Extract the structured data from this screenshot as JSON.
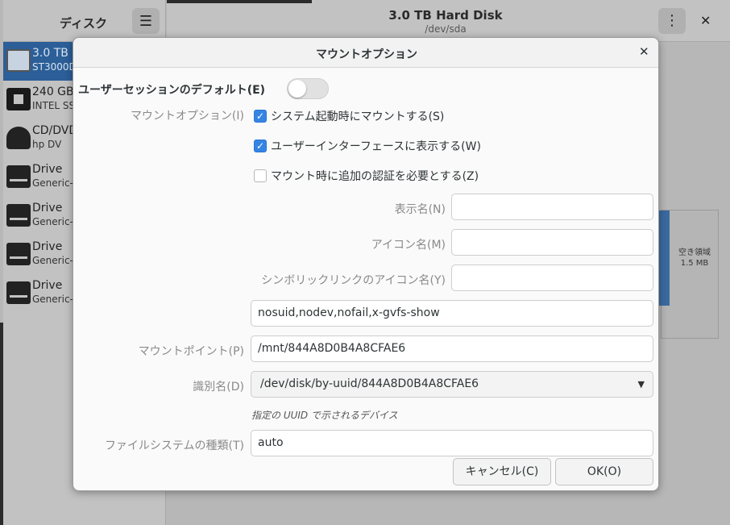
{
  "app": {
    "sidebar_title": "ディスク",
    "menu_icon": "☰",
    "window_title": "3.0 TB Hard Disk",
    "window_subtitle": "/dev/sda",
    "kebab_icon": "⋮",
    "close_icon": "✕",
    "drives": [
      {
        "name": "3.0 TB",
        "sub": "ST3000D",
        "selected": true,
        "icon": "harddisk-icon"
      },
      {
        "name": "240 GB",
        "sub": "INTEL SS",
        "selected": false,
        "icon": "ssd-chip-icon"
      },
      {
        "name": "CD/DVD",
        "sub": "hp      DV",
        "selected": false,
        "icon": "optical-drive-icon"
      },
      {
        "name": "Drive",
        "sub": "Generic-",
        "selected": false,
        "icon": "drive-icon"
      },
      {
        "name": "Drive",
        "sub": "Generic-",
        "selected": false,
        "icon": "drive-icon"
      },
      {
        "name": "Drive",
        "sub": "Generic-",
        "selected": false,
        "icon": "drive-icon"
      },
      {
        "name": "Drive",
        "sub": "Generic-",
        "selected": false,
        "icon": "drive-icon"
      }
    ],
    "free_space_label": "空き領域",
    "free_space_size": "1.5 MB"
  },
  "dialog": {
    "title": "マウントオプション",
    "close_icon": "✕",
    "session_default_label": "ユーザーセッションのデフォルト(E)",
    "session_default_on": false,
    "mount_options_label": "マウントオプション(I)",
    "checkboxes": [
      {
        "label": "システム起動時にマウントする(S)",
        "checked": true
      },
      {
        "label": "ユーザーインターフェースに表示する(W)",
        "checked": true
      },
      {
        "label": "マウント時に追加の認証を必要とする(Z)",
        "checked": false
      }
    ],
    "display_name_label": "表示名(N)",
    "display_name_value": "",
    "icon_name_label": "アイコン名(M)",
    "icon_name_value": "",
    "symbolic_icon_label": "シンボリックリンクのアイコン名(Y)",
    "symbolic_icon_value": "",
    "options_value": "nosuid,nodev,nofail,x-gvfs-show",
    "mount_point_label": "マウントポイント(P)",
    "mount_point_value": "/mnt/844A8D0B4A8CFAE6",
    "identify_label": "識別名(D)",
    "identify_value": "/dev/disk/by-uuid/844A8D0B4A8CFAE6",
    "identify_hint": "指定の UUID で示されるデバイス",
    "fstype_label": "ファイルシステムの種類(T)",
    "fstype_value": "auto",
    "cancel_label": "キャンセル(C)",
    "ok_label": "OK(O)"
  },
  "colors": {
    "accent": "#3584e4",
    "selection": "#2c5f98"
  }
}
